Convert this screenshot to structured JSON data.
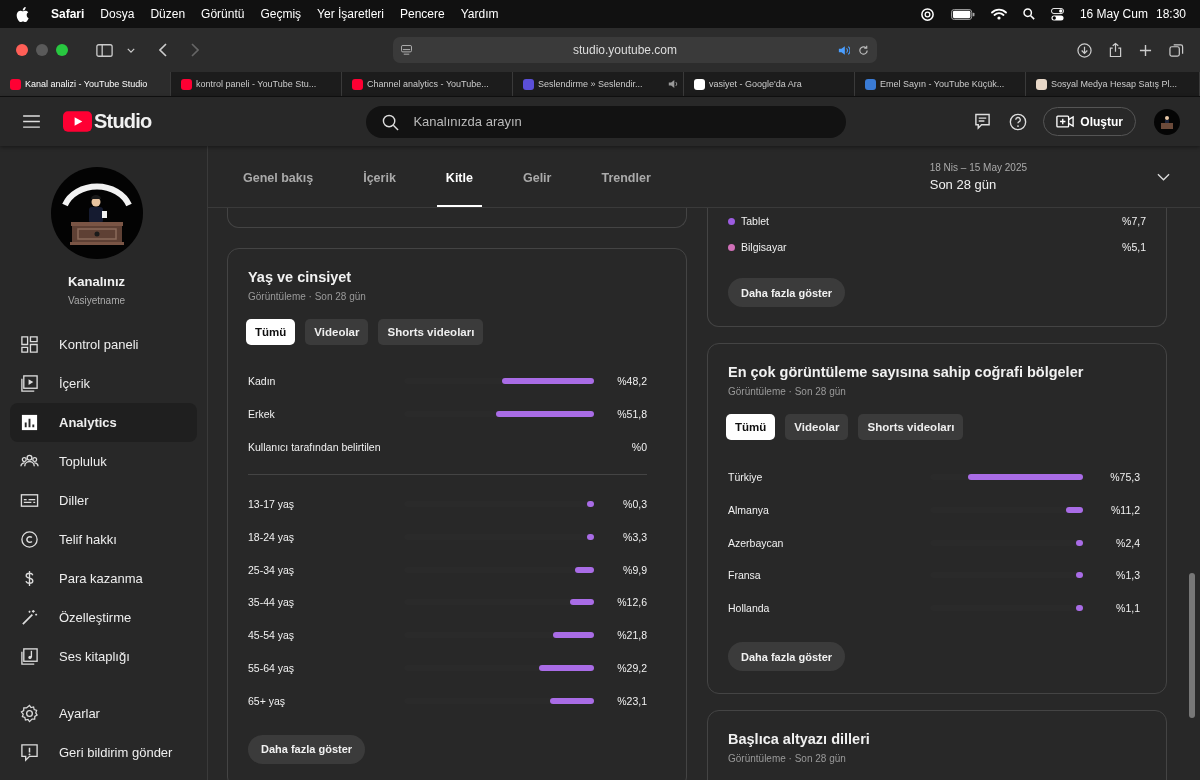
{
  "menu_bar": {
    "app": "Safari",
    "items": [
      "Dosya",
      "Düzen",
      "Görüntü",
      "Geçmiş",
      "Yer İşaretleri",
      "Pencere",
      "Yardım"
    ],
    "date": "16 May Cum",
    "time": "18:30"
  },
  "browser": {
    "url": "studio.youtube.com",
    "tabs": [
      {
        "title": "Kanal analizi - YouTube Studio",
        "selected": true,
        "audio": false
      },
      {
        "title": "kontrol paneli - YouTube Stu...",
        "selected": false,
        "audio": false
      },
      {
        "title": "Channel analytics - YouTube...",
        "selected": false,
        "audio": false
      },
      {
        "title": "Seslendirme » Seslendir...",
        "selected": false,
        "audio": true
      },
      {
        "title": "vasiyet - Google'da Ara",
        "selected": false,
        "audio": false
      },
      {
        "title": "Emel Sayın - YouTube Küçük...",
        "selected": false,
        "audio": false
      },
      {
        "title": "Sosyal Medya Hesap Satış Pl...",
        "selected": false,
        "audio": false
      }
    ]
  },
  "header": {
    "logo_text": "Studio",
    "search": {
      "placeholder": "Kanalınızda arayın"
    },
    "create_button": "Oluştur"
  },
  "sidebar": {
    "channel_title": "Kanalınız",
    "channel_name": "Vasiyetname",
    "items": [
      {
        "label": "Kontrol paneli",
        "selected": false
      },
      {
        "label": "İçerik",
        "selected": false
      },
      {
        "label": "Analytics",
        "selected": true
      },
      {
        "label": "Topluluk",
        "selected": false
      },
      {
        "label": "Diller",
        "selected": false
      },
      {
        "label": "Telif hakkı",
        "selected": false
      },
      {
        "label": "Para kazanma",
        "selected": false
      },
      {
        "label": "Özelleştirme",
        "selected": false
      },
      {
        "label": "Ses kitaplığı",
        "selected": false
      }
    ],
    "footer_items": [
      {
        "label": "Ayarlar"
      },
      {
        "label": "Geri bildirim gönder"
      }
    ]
  },
  "analytics_tabs": [
    {
      "label": "Genel bakış",
      "selected": false
    },
    {
      "label": "İçerik",
      "selected": false
    },
    {
      "label": "Kitle",
      "selected": true
    },
    {
      "label": "Gelir",
      "selected": false
    },
    {
      "label": "Trendler",
      "selected": false
    }
  ],
  "date_range": {
    "dates": "18 Nis – 15 May 2025",
    "period": "Son 28 gün"
  },
  "age_gender": {
    "title": "Yaş ve cinsiyet",
    "subtitle": "Görüntüleme · Son 28 gün",
    "filters": [
      {
        "label": "Tümü",
        "selected": true
      },
      {
        "label": "Videolar",
        "selected": false
      },
      {
        "label": "Shorts videoları",
        "selected": false
      }
    ],
    "gender_rows": [
      {
        "label": "Kadın",
        "level": 0.482,
        "reading": "%48,2"
      },
      {
        "label": "Erkek",
        "level": 0.518,
        "reading": "%51,8"
      },
      {
        "label": "Kullanıcı tarafından belirtilen",
        "reading": "%0"
      }
    ],
    "age_rows": [
      {
        "label": "13-17 yaş",
        "level": 0.003,
        "reading": "%0,3"
      },
      {
        "label": "18-24 yaş",
        "level": 0.033,
        "reading": "%3,3"
      },
      {
        "label": "25-34 yaş",
        "level": 0.099,
        "reading": "%9,9"
      },
      {
        "label": "35-44 yaş",
        "level": 0.126,
        "reading": "%12,6"
      },
      {
        "label": "45-54 yaş",
        "level": 0.218,
        "reading": "%21,8"
      },
      {
        "label": "55-64 yaş",
        "level": 0.292,
        "reading": "%29,2"
      },
      {
        "label": "65+ yaş",
        "level": 0.231,
        "reading": "%23,1"
      }
    ],
    "more_button": "Daha fazla göster"
  },
  "devices": {
    "rows": [
      {
        "label": "Tablet",
        "color": "#9c5ce0",
        "reading": "%7,7"
      },
      {
        "label": "Bilgisayar",
        "color": "#d070b8",
        "reading": "%5,1"
      }
    ],
    "more_button": "Daha fazla göster"
  },
  "geography": {
    "title": "En çok görüntüleme sayısına sahip coğrafi bölgeler",
    "subtitle": "Görüntüleme · Son 28 gün",
    "filters": [
      {
        "label": "Tümü",
        "selected": true
      },
      {
        "label": "Videolar",
        "selected": false
      },
      {
        "label": "Shorts videoları",
        "selected": false
      }
    ],
    "rows": [
      {
        "label": "Türkiye",
        "level": 0.753,
        "reading": "%75,3"
      },
      {
        "label": "Almanya",
        "level": 0.112,
        "reading": "%11,2"
      },
      {
        "label": "Azerbaycan",
        "level": 0.024,
        "reading": "%2,4"
      },
      {
        "label": "Fransa",
        "level": 0.013,
        "reading": "%1,3"
      },
      {
        "label": "Hollanda",
        "level": 0.011,
        "reading": "%1,1"
      }
    ],
    "more_button": "Daha fazla göster"
  },
  "subtitle_languages": {
    "title": "Başlıca altyazı dilleri",
    "subtitle": "Görüntüleme · Son 28 gün"
  }
}
